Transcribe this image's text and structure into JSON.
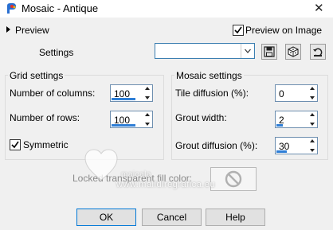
{
  "window": {
    "title": "Mosaic - Antique",
    "close_glyph": "✕"
  },
  "preview": {
    "label": "Preview",
    "preview_on_image_label": "Preview on Image",
    "preview_on_image_checked": true
  },
  "settings": {
    "label": "Settings",
    "preset_value": "",
    "buttons": [
      "save-preset-icon",
      "randomize-icon",
      "reset-icon"
    ]
  },
  "grid_settings": {
    "title": "Grid settings",
    "columns_label": "Number of columns:",
    "columns_value": "100",
    "rows_label": "Number of rows:",
    "rows_value": "100",
    "symmetric_label": "Symmetric",
    "symmetric_checked": true
  },
  "mosaic_settings": {
    "title": "Mosaic settings",
    "tile_diffusion_label": "Tile diffusion (%):",
    "tile_diffusion_value": "0",
    "grout_width_label": "Grout width:",
    "grout_width_value": "2",
    "grout_diffusion_label": "Grout diffusion (%):",
    "grout_diffusion_value": "30"
  },
  "locked": {
    "label": "Locked transparent fill color:"
  },
  "watermark": {
    "line1": "maicala",
    "line2": "www.maildiregrafica.eu"
  },
  "buttons": {
    "ok": "OK",
    "cancel": "Cancel",
    "help": "Help"
  }
}
